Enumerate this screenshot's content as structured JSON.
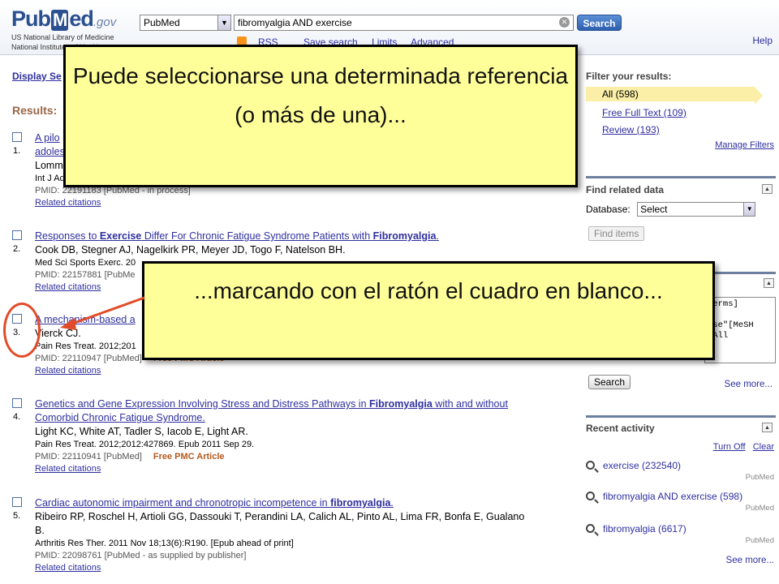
{
  "header": {
    "logo_left": "Pub",
    "logo_m": "M",
    "logo_right": "ed",
    "logo_gov": ".gov",
    "org_line1": "US National Library of Medicine",
    "org_line2": "National Institutes of Health",
    "database": "PubMed",
    "query": "fibromyalgia AND exercise",
    "search_label": "Search",
    "links": [
      "RSS",
      "Save search",
      "Limits",
      "Advanced"
    ],
    "help": "Help"
  },
  "display_settings": "Display Se",
  "results_heading": "Results:",
  "results": [
    {
      "num": "1.",
      "title_parts": [
        "A pilo",
        "",
        "adoles"
      ],
      "authors": "Lomm",
      "journal": "Int J Ad",
      "pmid": "PMID: 22191183 [PubMed - in process]",
      "free": "",
      "related": "Related citations"
    },
    {
      "num": "2.",
      "title_parts": [
        "Responses to ",
        "Exercise",
        " Differ For Chronic Fatigue Syndrome Patients with ",
        "Fibromyalgia",
        "."
      ],
      "authors": "Cook DB, Stegner AJ, Nagelkirk PR, Meyer JD, Togo F, Natelson BH.",
      "journal": "Med Sci Sports Exerc. 20",
      "pmid": "PMID: 22157881 [PubMe",
      "free": "",
      "related": "Related citations"
    },
    {
      "num": "3.",
      "title_parts": [
        "A mechanism-based a"
      ],
      "authors": "Vierck CJ.",
      "journal": "Pain Res Treat. 2012;201",
      "pmid": "PMID: 22110947 [PubMed]",
      "free": "Free PMC Article",
      "related": "Related citations"
    },
    {
      "num": "4.",
      "title_line1_parts": [
        "Genetics and Gene Expression Involving Stress and Distress Pathways in ",
        "Fibromyalgia",
        " with and without"
      ],
      "title_line2": "Comorbid Chronic Fatigue Syndrome.",
      "authors": "Light KC, White AT, Tadler S, Iacob E, Light AR.",
      "journal": "Pain Res Treat. 2012;2012:427869. Epub 2011 Sep 29.",
      "pmid": "PMID: 22110941 [PubMed]",
      "free": "Free PMC Article",
      "related": "Related citations"
    },
    {
      "num": "5.",
      "title_parts": [
        "Cardiac autonomic impairment and chronotropic incompetence in ",
        "fibromyalgia",
        "."
      ],
      "authors_line1": "Ribeiro RP, Roschel H, Artioli GG, Dassouki T, Perandini LA, Calich AL, Pinto AL, Lima FR, Bonfa E, Gualano",
      "authors_line2": "B.",
      "journal": "Arthritis Res Ther. 2011 Nov 18;13(6):R190. [Epub ahead of print]",
      "pmid": "PMID: 22098761 [PubMed - as supplied by publisher]",
      "related": "Related citations"
    }
  ],
  "sidebar": {
    "filter_heading": "Filter your results:",
    "filters": [
      "All (598)",
      "Free Full Text (109)",
      "Review (193)"
    ],
    "manage_filters": "Manage Filters",
    "related_heading": "Find related data",
    "database_label": "Database:",
    "database_value": "Select",
    "find_items": "Find items",
    "details_text": "Terms]\n1\nise\"[MeSH\n[All",
    "search_button": "Search",
    "see_more": "See more...",
    "recent_heading": "Recent activity",
    "turn_off": "Turn Off",
    "clear": "Clear",
    "recent": [
      {
        "query": "exercise (232540)",
        "source": "PubMed"
      },
      {
        "query": "fibromyalgia AND exercise (598)",
        "source": "PubMed"
      },
      {
        "query": "fibromyalgia (6617)",
        "source": "PubMed"
      }
    ],
    "see_more_2": "See more..."
  },
  "callouts": {
    "top": "Puede seleccionarse una determinada referencia (o más de una)...",
    "bottom": "...marcando con el ratón el cuadro en blanco..."
  },
  "colors": {
    "callout_bg": "#ffff99",
    "highlight_red": "#e24b28",
    "link": "#2f2fa0"
  }
}
